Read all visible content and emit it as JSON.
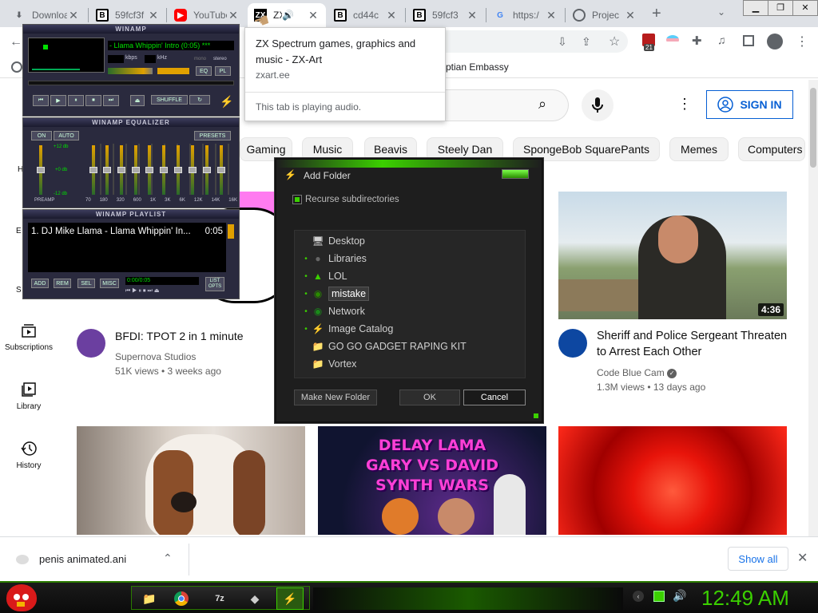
{
  "tabs": [
    {
      "title": "Download",
      "favicon": "download-icon"
    },
    {
      "title": "59fcf3f",
      "favicon": "b-icon"
    },
    {
      "title": "YouTube",
      "favicon": "youtube-icon"
    },
    {
      "title": "ZX",
      "favicon": "zx-icon"
    },
    {
      "title": "cd44c",
      "favicon": "b-icon"
    },
    {
      "title": "59fcf3",
      "favicon": "b-icon"
    },
    {
      "title": "https:/",
      "favicon": "google-icon"
    },
    {
      "title": "Projec",
      "favicon": "globe-icon"
    }
  ],
  "tab_tooltip": {
    "title": "ZX Spectrum games, graphics and music - ZX-Art",
    "domain": "zxart.ee",
    "audio_note": "This tab is playing audio."
  },
  "bookmarks": {
    "visible_item": "ptian Embassy"
  },
  "extension_badge": "21",
  "youtube": {
    "sign_in": "SIGN IN",
    "chips": [
      "Gaming",
      "Music",
      "Beavis",
      "Steely Dan",
      "SpongeBob SquarePants",
      "Memes",
      "Computers"
    ],
    "sidebar": [
      {
        "label": "Subscriptions",
        "icon": "subscriptions-icon"
      },
      {
        "label": "Library",
        "icon": "library-icon"
      },
      {
        "label": "History",
        "icon": "history-icon"
      }
    ],
    "videos": [
      {
        "title": "BFDI: TPOT 2 in 1 minute",
        "channel": "Supernova Studios",
        "meta": "51K views • 3 weeks ago"
      },
      {
        "title": "Sheriff and Police Sergeant Threaten to Arrest Each Other",
        "channel": "Code Blue Cam",
        "meta": "1.3M views • 13 days ago",
        "duration": "4:36"
      }
    ],
    "thumb2_lines": [
      "DELAY LAMA",
      "GARY VS DAVID",
      "SYNTH WARS"
    ]
  },
  "winamp": {
    "title": "WINAMP",
    "song": "- Llama Whippin' Intro (0:05) ***",
    "kbps_label": "kbps",
    "khz_label": "kHz",
    "mono": "mono",
    "stereo": "stereo",
    "eq_btn": "EQ",
    "pl_btn": "PL",
    "shuffle": "SHUFFLE",
    "eq_title": "WINAMP EQUALIZER",
    "eq_on": "ON",
    "eq_auto": "AUTO",
    "eq_presets": "PRESETS",
    "eq_db": [
      "+12 db",
      "+0 db",
      "-12 db"
    ],
    "eq_preamp": "PREAMP",
    "eq_bands": [
      "70",
      "180",
      "320",
      "600",
      "1K",
      "3K",
      "6K",
      "12K",
      "14K",
      "16K"
    ],
    "pl_title": "WINAMP PLAYLIST",
    "playlist_item": "1. DJ Mike Llama - Llama Whippin' In...",
    "playlist_time": "0:05",
    "pl_buttons": [
      "ADD",
      "REM",
      "SEL",
      "MISC"
    ],
    "pl_time": "0:00/0:05",
    "pl_list": "LIST OPTS"
  },
  "dialog": {
    "title": "Add Folder",
    "recurse": "Recurse subdirectories",
    "tree": [
      {
        "label": "Desktop",
        "icon": "desktop-icon",
        "bullet": false
      },
      {
        "label": "Libraries",
        "icon": "libraries-icon",
        "bullet": true
      },
      {
        "label": "LOL",
        "icon": "folder-icon",
        "bullet": true
      },
      {
        "label": "mistake",
        "icon": "folder-icon",
        "bullet": true,
        "selected": true
      },
      {
        "label": "Network",
        "icon": "network-icon",
        "bullet": true
      },
      {
        "label": "Image Catalog",
        "icon": "image-catalog-icon",
        "bullet": true
      },
      {
        "label": "GO GO GADGET RAPING KIT",
        "icon": "folder-icon",
        "bullet": false
      },
      {
        "label": "Vortex",
        "icon": "folder-icon",
        "bullet": false
      }
    ],
    "make_new_folder": "Make New Folder",
    "ok": "OK",
    "cancel": "Cancel"
  },
  "download_bar": {
    "file": "penis animated.ani",
    "show_all": "Show all"
  },
  "taskbar": {
    "clock": "12:49 AM"
  },
  "colors": {
    "winamp_green": "#00e000",
    "taskbar_green": "#3bd000",
    "youtube_blue": "#065fd4"
  }
}
